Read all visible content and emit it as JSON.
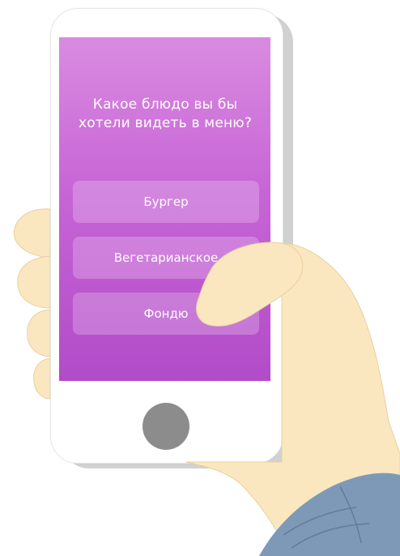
{
  "quiz": {
    "question": "Какое блюдо вы бы хотели видеть в меню?",
    "options": [
      "Бургер",
      "Вегетарианское",
      "Фондю"
    ]
  },
  "colors": {
    "screen_top": "#d98be0",
    "screen_bottom": "#b24bc8",
    "option_bg": "rgba(255,255,255,0.22)",
    "skin": "#fbe7bf",
    "sleeve": "#7e99b8",
    "home_button": "#8c8c8c"
  }
}
